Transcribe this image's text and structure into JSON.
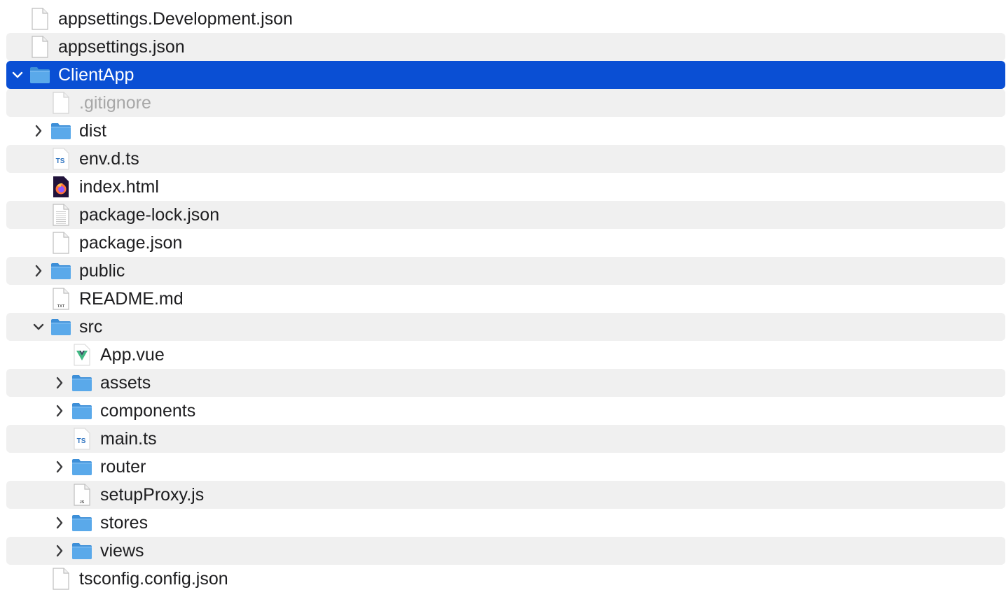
{
  "colors": {
    "selection": "#0a4fd4",
    "stripe": "#f0f0f0",
    "folder": "#5aa9ea",
    "text": "#1d1d1f",
    "dim_text": "#a7a7a7"
  },
  "rows": [
    {
      "name": "appsettings.Development.json",
      "kind": "file",
      "icon": "document-icon",
      "depth": 0
    },
    {
      "name": "appsettings.json",
      "kind": "file",
      "icon": "document-icon",
      "depth": 0
    },
    {
      "name": "ClientApp",
      "kind": "folder",
      "icon": "folder-icon",
      "depth": 0,
      "expanded": true,
      "selected": true
    },
    {
      "name": ".gitignore",
      "kind": "file",
      "icon": "document-icon",
      "depth": 1,
      "dimmed": true
    },
    {
      "name": "dist",
      "kind": "folder",
      "icon": "folder-icon",
      "depth": 1,
      "expanded": false
    },
    {
      "name": "env.d.ts",
      "kind": "file",
      "icon": "typescript-file-icon",
      "icon_text": "TS",
      "depth": 1
    },
    {
      "name": "index.html",
      "kind": "file",
      "icon": "firefox-html-icon",
      "depth": 1
    },
    {
      "name": "package-lock.json",
      "kind": "file",
      "icon": "text-document-icon",
      "depth": 1
    },
    {
      "name": "package.json",
      "kind": "file",
      "icon": "document-icon",
      "depth": 1
    },
    {
      "name": "public",
      "kind": "folder",
      "icon": "folder-icon",
      "depth": 1,
      "expanded": false
    },
    {
      "name": "README.md",
      "kind": "file",
      "icon": "txt-file-icon",
      "icon_text": "TXT",
      "depth": 1
    },
    {
      "name": "src",
      "kind": "folder",
      "icon": "folder-icon",
      "depth": 1,
      "expanded": true
    },
    {
      "name": "App.vue",
      "kind": "file",
      "icon": "vue-file-icon",
      "depth": 2
    },
    {
      "name": "assets",
      "kind": "folder",
      "icon": "folder-icon",
      "depth": 2,
      "expanded": false
    },
    {
      "name": "components",
      "kind": "folder",
      "icon": "folder-icon",
      "depth": 2,
      "expanded": false
    },
    {
      "name": "main.ts",
      "kind": "file",
      "icon": "typescript-file-icon",
      "icon_text": "TS",
      "depth": 2
    },
    {
      "name": "router",
      "kind": "folder",
      "icon": "folder-icon",
      "depth": 2,
      "expanded": false
    },
    {
      "name": "setupProxy.js",
      "kind": "file",
      "icon": "javascript-file-icon",
      "icon_text": "JS",
      "depth": 2
    },
    {
      "name": "stores",
      "kind": "folder",
      "icon": "folder-icon",
      "depth": 2,
      "expanded": false
    },
    {
      "name": "views",
      "kind": "folder",
      "icon": "folder-icon",
      "depth": 2,
      "expanded": false
    },
    {
      "name": "tsconfig.config.json",
      "kind": "file",
      "icon": "document-icon",
      "depth": 1
    }
  ]
}
